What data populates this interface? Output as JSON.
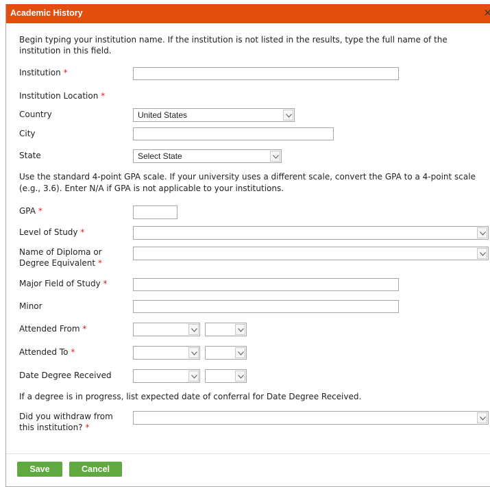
{
  "dialog": {
    "title": "Academic History",
    "close_glyph": "×"
  },
  "colors": {
    "titlebar": "#e34d0e",
    "button": "#5fa93e",
    "required": "#e01b1b"
  },
  "instructions": {
    "institution_line1": "Begin typing your institution name. If the institution is not listed in the results, type the full name of the",
    "institution_line2": "institution in this field.",
    "gpa_line1": "Use the standard 4-point GPA scale. If your university uses a different scale, convert the GPA to a 4-point scale",
    "gpa_line2": "(e.g., 3.6). Enter N/A if GPA is not applicable to your institutions.",
    "degree_note": "If a degree is in progress, list expected date of conferral for Date Degree Received."
  },
  "required_mark": "*",
  "fields": {
    "institution": {
      "label": "Institution",
      "value": ""
    },
    "institution_location": {
      "label": "Institution Location"
    },
    "country": {
      "label": "Country",
      "value": "United States"
    },
    "city": {
      "label": "City",
      "value": ""
    },
    "state": {
      "label": "State",
      "value": "Select State"
    },
    "gpa": {
      "label": "GPA",
      "value": ""
    },
    "level_of_study": {
      "label": "Level of Study",
      "value": ""
    },
    "diploma": {
      "label_line1": "Name of Diploma or",
      "label_line2": "Degree Equivalent",
      "value": ""
    },
    "major": {
      "label": "Major Field of Study",
      "value": ""
    },
    "minor": {
      "label": "Minor",
      "value": ""
    },
    "attended_from": {
      "label": "Attended From",
      "month": "",
      "year": ""
    },
    "attended_to": {
      "label": "Attended To",
      "month": "",
      "year": ""
    },
    "date_degree_received": {
      "label": "Date Degree Received",
      "month": "",
      "year": ""
    },
    "withdraw": {
      "label_line1": "Did you withdraw from",
      "label_line2": "this institution?",
      "value": ""
    }
  },
  "buttons": {
    "save": "Save",
    "cancel": "Cancel"
  },
  "icons": {
    "dropdown": "chevron-down-icon",
    "close": "close-icon"
  }
}
